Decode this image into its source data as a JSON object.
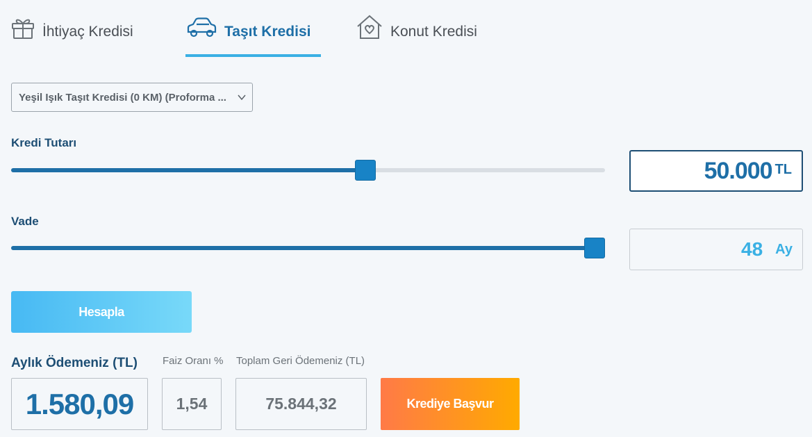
{
  "tabs": [
    {
      "label": "İhtiyaç Kredisi",
      "icon": "gift-icon",
      "active": false
    },
    {
      "label": "Taşıt Kredisi",
      "icon": "car-icon",
      "active": true
    },
    {
      "label": "Konut Kredisi",
      "icon": "house-heart-icon",
      "active": false
    }
  ],
  "product_select": {
    "value": "Yeşil Işık Taşıt Kredisi (0 KM) (Proforma ..."
  },
  "loan_amount": {
    "label": "Kredi Tutarı",
    "value": "50.000",
    "unit": "TL",
    "slider_fraction": 0.6
  },
  "term": {
    "label": "Vade",
    "value": "48",
    "unit": "Ay",
    "slider_fraction": 1.0
  },
  "calculate_button": "Hesapla",
  "results": {
    "monthly_label": "Aylık Ödemeniz (TL)",
    "monthly_value": "1.580,09",
    "rate_label": "Faiz Oranı %",
    "rate_value": "1,54",
    "total_label": "Toplam Geri Ödemeniz (TL)",
    "total_value": "75.844,32"
  },
  "apply_button": "Krediye Başvur",
  "colors": {
    "primary": "#1e6fa7",
    "accent": "#3ab0e4",
    "apply_from": "#ff7a47",
    "apply_to": "#ffaa00"
  }
}
